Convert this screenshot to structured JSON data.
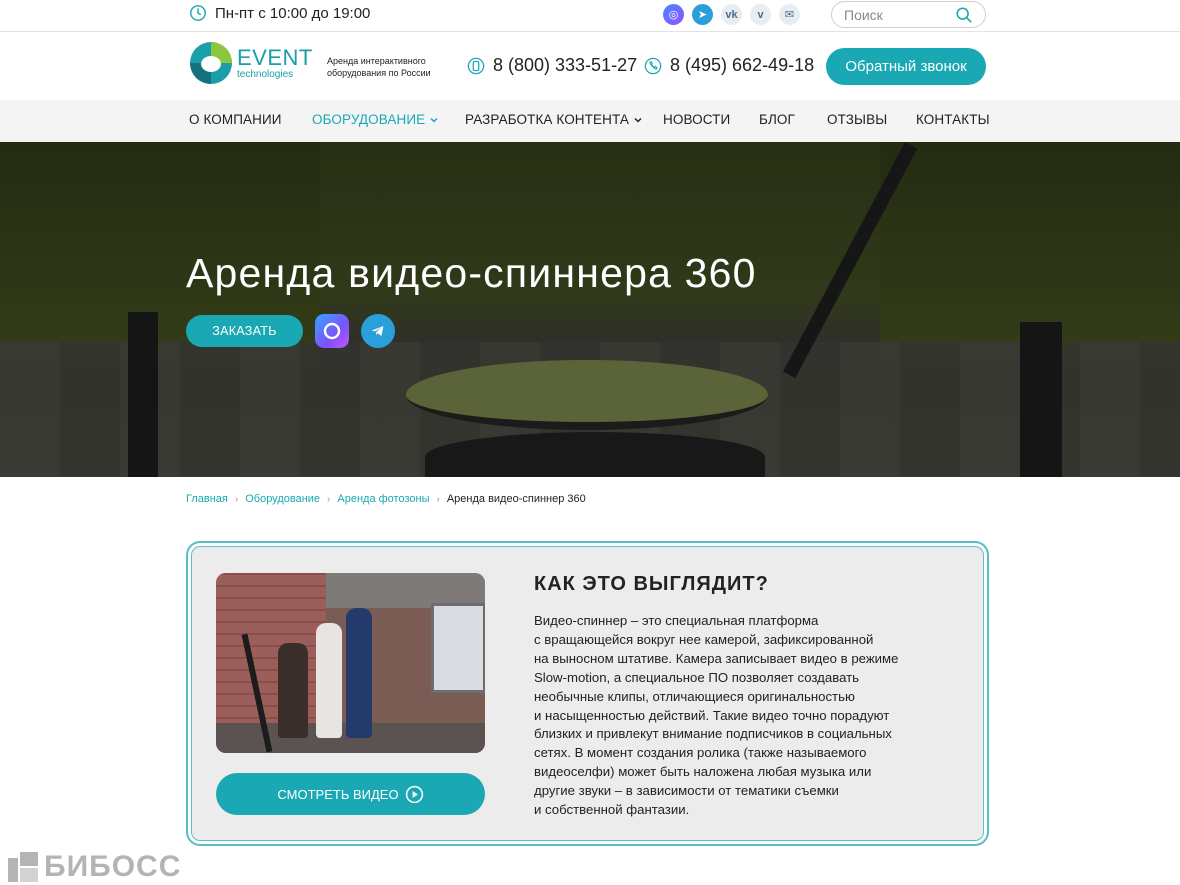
{
  "topbar": {
    "hours": "Пн-пт с 10:00 до 19:00",
    "search_placeholder": "Поиск",
    "socials": [
      "max-icon",
      "telegram-icon",
      "vk-icon",
      "viber-icon",
      "mail-icon"
    ]
  },
  "header": {
    "logo_word": "EVENT",
    "logo_sub": "technologies",
    "tagline": "Аренда интерактивного оборудования по России",
    "phone1": "8 (800) 333-51-27",
    "phone2": "8 (495) 662-49-18",
    "callback_label": "Обратный звонок"
  },
  "nav": {
    "items": [
      {
        "label": "О КОМПАНИИ"
      },
      {
        "label": "ОБОРУДОВАНИЕ"
      },
      {
        "label": "РАЗРАБОТКА КОНТЕНТА"
      },
      {
        "label": "НОВОСТИ"
      },
      {
        "label": "БЛОГ"
      },
      {
        "label": "ОТЗЫВЫ"
      },
      {
        "label": "КОНТАКТЫ"
      }
    ]
  },
  "hero": {
    "title": "Аренда видео-спиннера 360",
    "order_label": "ЗАКАЗАТЬ"
  },
  "breadcrumb": [
    "Главная",
    "Оборудование",
    "Аренда фотозоны",
    "Аренда видео-спиннер 360"
  ],
  "card": {
    "title": "КАК ЭТО ВЫГЛЯДИТ?",
    "watch_label": "СМОТРЕТЬ ВИДЕО",
    "lines": [
      "Видео-спиннер – это специальная платформа",
      "с вращающейся вокруг нее камерой, зафиксированной",
      "на выносном штативе. Камера записывает видео в режиме",
      "Slow-motion, а специальное ПО позволяет создавать",
      "необычные клипы, отличающиеся оригинальностью",
      "и насыщенностью действий. Такие видео точно порадуют",
      "близких и привлекут внимание подписчиков в социальных",
      "сетях. В момент создания ролика (также называемого",
      "видеоселфи) может быть наложена любая музыка или",
      "другие звуки – в зависимости от тематики съемки",
      "и собственной фантазии."
    ]
  },
  "watermark": "БИБОСС",
  "colors": {
    "accent": "#1aa9b4",
    "card_border": "#5bbfc6",
    "nav_bg": "#f4f4f4"
  }
}
